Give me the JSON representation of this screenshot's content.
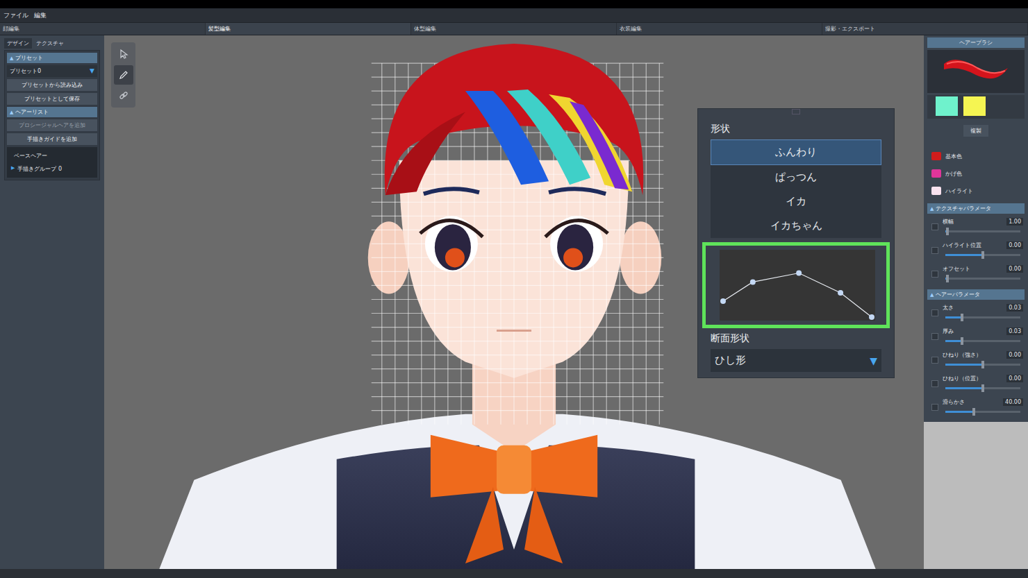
{
  "menu": [
    "ファイル",
    "編集"
  ],
  "tabs": [
    {
      "label": "顔編集",
      "selected": false
    },
    {
      "label": "髪型編集",
      "selected": true
    },
    {
      "label": "体型編集",
      "selected": false
    },
    {
      "label": "衣装編集",
      "selected": false
    },
    {
      "label": "撮影・エクスポート",
      "selected": false
    }
  ],
  "left_panel": {
    "tabs": [
      {
        "label": "デザイン",
        "selected": true
      },
      {
        "label": "テクスチャ",
        "selected": false
      }
    ],
    "preset_section": {
      "marker": "▲",
      "title": "プリセット",
      "expanded": true
    },
    "preset_dropdown": {
      "value": "プリセット0",
      "arrow": "▼"
    },
    "preset_buttons": [
      "プリセットから読み込み",
      "プリセットとして保存"
    ],
    "hair_section": {
      "marker": "▲",
      "title": "ヘアーリスト",
      "expanded": true
    },
    "hair_buttons": [
      {
        "label": "プロシージャルヘアを追加",
        "disabled": true
      },
      {
        "label": "手描きガイドを追加",
        "disabled": false
      }
    ],
    "hair_list": [
      {
        "label": "ベースヘアー",
        "marker": "",
        "expanded": false
      },
      {
        "label": "手描きグループ 0",
        "marker": "▶",
        "expanded": false
      }
    ]
  },
  "tools": [
    {
      "kind": "select",
      "selected": false
    },
    {
      "kind": "pen",
      "selected": true
    },
    {
      "kind": "link",
      "selected": false
    }
  ],
  "shape_panel": {
    "title": "形状",
    "options": [
      {
        "label": "ふんわり",
        "selected": true
      },
      {
        "label": "ぱっつん",
        "selected": false
      },
      {
        "label": "イカ",
        "selected": false
      },
      {
        "label": "イカちゃん",
        "selected": false
      }
    ],
    "curve": [
      {
        "x": 0,
        "y": 0.25
      },
      {
        "x": 0.2,
        "y": 0.55
      },
      {
        "x": 0.51,
        "y": 0.69
      },
      {
        "x": 0.79,
        "y": 0.38
      },
      {
        "x": 1,
        "y": 0
      }
    ],
    "section_label": "断面形状",
    "section_dropdown": {
      "value": "ひし形",
      "arrow": "▼"
    }
  },
  "right_panel": {
    "title": "ヘアーブラシ",
    "swatches": [
      {
        "color": "#6ff2cc"
      },
      {
        "color": "#f5f552"
      }
    ],
    "duplicate_button": "複製",
    "colors": [
      {
        "label": "基本色",
        "color": "#d01c1c"
      },
      {
        "label": "かげ色",
        "color": "#e0359a"
      },
      {
        "label": "ハイライト",
        "color": "#f8e2ee"
      }
    ],
    "sections": [
      {
        "marker": "▲",
        "title": "テクスチャパラメータ",
        "params": [
          {
            "label": "横幅",
            "value": "1.00",
            "level": 0.03,
            "checked": false
          },
          {
            "label": "ハイライト位置",
            "value": "0.00",
            "level": 0.5,
            "checked": false
          },
          {
            "label": "オフセット",
            "value": "0.00",
            "level": 0.03,
            "checked": false
          }
        ]
      },
      {
        "marker": "▲",
        "title": "ヘアーパラメータ",
        "params": [
          {
            "label": "太さ",
            "value": "0.03",
            "level": 0.22,
            "checked": false
          },
          {
            "label": "厚み",
            "value": "0.03",
            "level": 0.22,
            "checked": false
          },
          {
            "label": "ひねり（強さ）",
            "value": "0.00",
            "level": 0.5,
            "checked": false
          },
          {
            "label": "ひねり（位置）",
            "value": "0.00",
            "level": 0.5,
            "checked": false
          },
          {
            "label": "滑らかさ",
            "value": "40.00",
            "level": 0.38,
            "checked": false
          }
        ]
      }
    ]
  }
}
